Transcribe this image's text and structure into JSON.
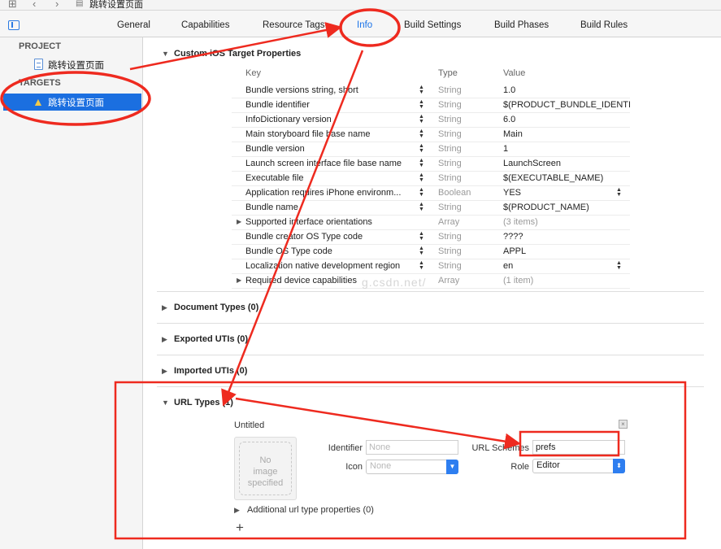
{
  "navbar": {
    "breadcrumb": "跳转设置页面"
  },
  "tabs": [
    {
      "label": "General"
    },
    {
      "label": "Capabilities"
    },
    {
      "label": "Resource Tags"
    },
    {
      "label": "Info"
    },
    {
      "label": "Build Settings"
    },
    {
      "label": "Build Phases"
    },
    {
      "label": "Build Rules"
    }
  ],
  "sidebar": {
    "project_header": "PROJECT",
    "project_item": "跳转设置页面",
    "targets_header": "TARGETS",
    "target_item": "跳转设置页面"
  },
  "properties": {
    "title": "Custom iOS Target Properties",
    "col_key": "Key",
    "col_type": "Type",
    "col_value": "Value",
    "rows": [
      {
        "key": "Bundle versions string, short",
        "type": "String",
        "value": "1.0"
      },
      {
        "key": "Bundle identifier",
        "type": "String",
        "value": "$(PRODUCT_BUNDLE_IDENTI"
      },
      {
        "key": "InfoDictionary version",
        "type": "String",
        "value": "6.0"
      },
      {
        "key": "Main storyboard file base name",
        "type": "String",
        "value": "Main"
      },
      {
        "key": "Bundle version",
        "type": "String",
        "value": "1"
      },
      {
        "key": "Launch screen interface file base name",
        "type": "String",
        "value": "LaunchScreen"
      },
      {
        "key": "Executable file",
        "type": "String",
        "value": "$(EXECUTABLE_NAME)"
      },
      {
        "key": "Application requires iPhone environm...",
        "type": "Boolean",
        "value": "YES"
      },
      {
        "key": "Bundle name",
        "type": "String",
        "value": "$(PRODUCT_NAME)"
      },
      {
        "key": "Supported interface orientations",
        "type": "Array",
        "value": "(3 items)"
      },
      {
        "key": "Bundle creator OS Type code",
        "type": "String",
        "value": "????"
      },
      {
        "key": "Bundle OS Type code",
        "type": "String",
        "value": "APPL"
      },
      {
        "key": "Localization native development region",
        "type": "String",
        "value": "en"
      },
      {
        "key": "Required device capabilities",
        "type": "Array",
        "value": "(1 item)"
      }
    ]
  },
  "sections": {
    "document_types": "Document Types (0)",
    "exported_utis": "Exported UTIs (0)",
    "imported_utis": "Imported UTIs (0)",
    "url_types": "URL Types (1)"
  },
  "url_type": {
    "name": "Untitled",
    "no_image": [
      "No",
      "image",
      "specified"
    ],
    "identifier_label": "Identifier",
    "identifier_placeholder": "None",
    "icon_label": "Icon",
    "icon_value": "None",
    "url_schemes_label": "URL Schemes",
    "url_schemes_value": "prefs",
    "role_label": "Role",
    "role_value": "Editor",
    "additional_props": "Additional url type properties (0)",
    "add_symbol": "+"
  },
  "watermark": "g.csdn.net/",
  "colors": {
    "accent": "#1b6fe0",
    "annotation": "#ee2a1f"
  }
}
